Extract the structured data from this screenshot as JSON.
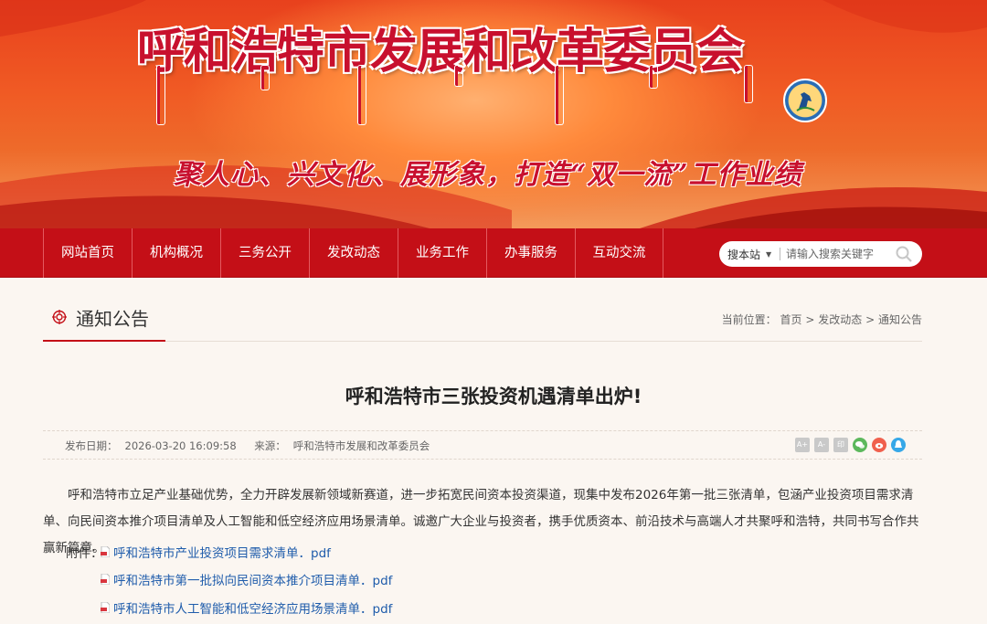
{
  "banner": {
    "title": "呼和浩特市发展和改革委员会",
    "slogan": "聚人心、兴文化、展形象，打造“双一流”工作业绩",
    "logo_icon": "horse-emblem-icon"
  },
  "nav": {
    "items": [
      {
        "label": "网站首页"
      },
      {
        "label": "机构概况"
      },
      {
        "label": "三务公开"
      },
      {
        "label": "发改动态"
      },
      {
        "label": "业务工作"
      },
      {
        "label": "办事服务"
      },
      {
        "label": "互动交流"
      }
    ],
    "search": {
      "scope": "搜本站",
      "placeholder": "请输入搜索关键字",
      "icon": "search-icon"
    }
  },
  "section": {
    "title": "通知公告",
    "breadcrumb": {
      "prefix": "当前位置：",
      "items": [
        "首页",
        "发改动态",
        "通知公告"
      ],
      "sep": ">"
    }
  },
  "article": {
    "title": "呼和浩特市三张投资机遇清单出炉!",
    "publish_label": "发布日期：",
    "publish_date": "2026-03-20 16:09:58",
    "source_label": "来源：",
    "source": "呼和浩特市发展和改革委员会",
    "share": {
      "font_large": "A+",
      "font_small": "A-",
      "print": "印"
    },
    "body": "呼和浩特市立足产业基础优势，全力开辟发展新领域新赛道，进一步拓宽民间资本投资渠道，现集中发布2026年第一批三张清单，包涵产业投资项目需求清单、向民间资本推介项目清单及人工智能和低空经济应用场景清单。诚邀广大企业与投资者，携手优质资本、前沿技术与高端人才共聚呼和浩特，共同书写合作共赢新篇章。",
    "attach_label": "附件：",
    "attachments": [
      "呼和浩特市产业投资项目需求清单．pdf",
      "呼和浩特市第一批拟向民间资本推介项目清单．pdf",
      "呼和浩特市人工智能和低空经济应用场景清单．pdf"
    ]
  },
  "colors": {
    "primary_red": "#c40f17",
    "link_blue": "#1f5cab",
    "page_bg": "#fbf6f1"
  }
}
